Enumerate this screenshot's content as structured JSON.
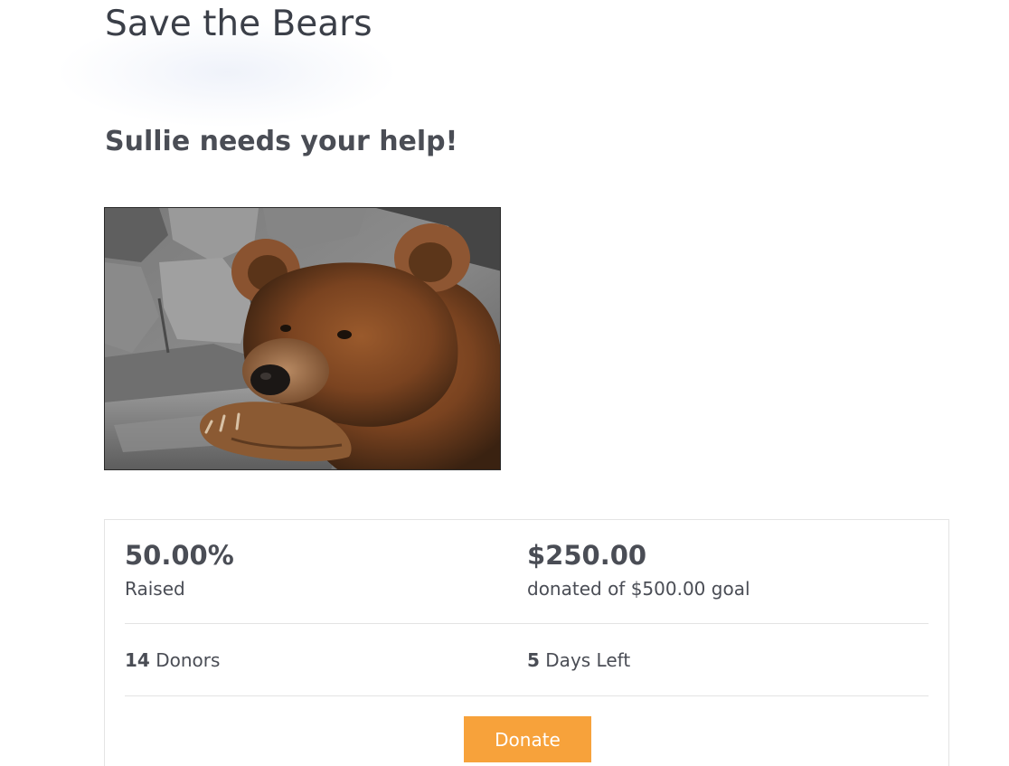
{
  "header": {
    "title": "Save the Bears"
  },
  "campaign": {
    "headline": "Sullie needs your help!",
    "image_alt": "brown bear resting its head on its paw"
  },
  "stats": {
    "percent_raised": "50.00%",
    "percent_label": "Raised",
    "amount_donated": "$250.00",
    "goal_label": "donated of $500.00 goal",
    "donor_count": "14",
    "donor_label": "Donors",
    "days_left_count": "5",
    "days_left_label": "Days Left"
  },
  "actions": {
    "donate_label": "Donate"
  },
  "colors": {
    "accent": "#f7a23b",
    "text": "#4a4d55"
  }
}
